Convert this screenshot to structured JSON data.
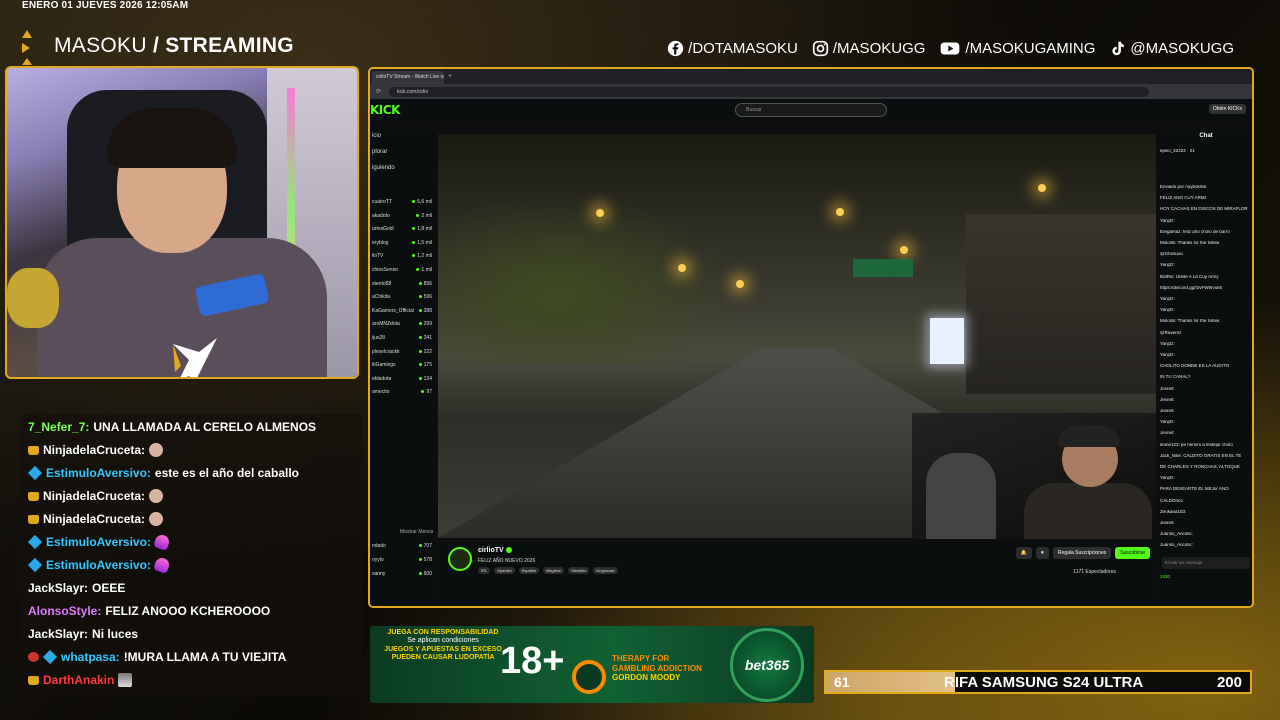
{
  "header": {
    "datetime": "ENERO 01 JUEVES 2026 12:05AM",
    "brand_light": "MASOKU ",
    "brand_bold": "/ STREAMING"
  },
  "socials": [
    {
      "icon": "facebook-icon",
      "label": "/DOTAMASOKU"
    },
    {
      "icon": "instagram-icon",
      "label": "/MASOKUGG"
    },
    {
      "icon": "youtube-icon",
      "label": "/MASOKUGAMING"
    },
    {
      "icon": "tiktok-icon",
      "label": "@MASOKUGG"
    }
  ],
  "overlay_chat": [
    {
      "user": "7_Nefer_7:",
      "color": "#7cff5a",
      "msg": "UNA LLAMADA AL CERELO ALMENOS",
      "badge": "",
      "emote": ""
    },
    {
      "user": "NinjadelaCruceta:",
      "color": "#ffffff",
      "msg": "",
      "badge": "crown",
      "emote": "face"
    },
    {
      "user": "EstimuloAversivo:",
      "color": "#33c7ff",
      "msg": "este es el año del caballo",
      "badge": "cube",
      "emote": ""
    },
    {
      "user": "NinjadelaCruceta:",
      "color": "#ffffff",
      "msg": "",
      "badge": "crown",
      "emote": "face"
    },
    {
      "user": "NinjadelaCruceta:",
      "color": "#ffffff",
      "msg": "",
      "badge": "crown",
      "emote": "face"
    },
    {
      "user": "EstimuloAversivo:",
      "color": "#33c7ff",
      "msg": "",
      "badge": "cube",
      "emote": "flame"
    },
    {
      "user": "EstimuloAversivo:",
      "color": "#33c7ff",
      "msg": "",
      "badge": "cube",
      "emote": "flame"
    },
    {
      "user": "JackSlayr:",
      "color": "#ffffff",
      "msg": "OEEE",
      "badge": "",
      "emote": ""
    },
    {
      "user": "AlonsoStyle:",
      "color": "#e07aff",
      "msg": "FELIZ ANOOO KCHEROOOO",
      "badge": "",
      "emote": ""
    },
    {
      "user": "JackSlayr:",
      "color": "#ffffff",
      "msg": "Ni luces",
      "badge": "",
      "emote": ""
    },
    {
      "user": "whatpasa:",
      "color": "#33c7ff",
      "msg": "!MURA LLAMA A TU VIEJITA",
      "badge": "bugcube",
      "emote": ""
    },
    {
      "user": "DarthAnakin",
      "color": "#ff3b3b",
      "msg": "",
      "badge": "crown",
      "emote": "img"
    }
  ],
  "browser": {
    "tab_title": "cirlioTV Stream - Watch Live on",
    "address": "kick.com/cirlio"
  },
  "kick": {
    "logo": "KICK",
    "search_placeholder": "Buscar",
    "login_label": "Obtén KICKs",
    "nav": [
      "icio",
      "plorar",
      "iguiendo"
    ],
    "channels": [
      {
        "name": "cuatroTT",
        "viewers": "5,6 mil"
      },
      {
        "name": "akadoto",
        "viewers": "2 mil"
      },
      {
        "name": "urinaGold",
        "viewers": "1,8 mil"
      },
      {
        "name": "eryblog",
        "viewers": "1,5 mil"
      },
      {
        "name": "lioTV",
        "viewers": "1,2 mil"
      },
      {
        "name": "chiesSenior",
        "viewers": "1 mil"
      },
      {
        "name": "stento58",
        "viewers": "896"
      },
      {
        "name": "aChikita",
        "viewers": "596"
      },
      {
        "name": "KaGamers_Official",
        "viewers": "388"
      },
      {
        "name": "aroMNZdota",
        "viewers": "299"
      },
      {
        "name": "ijus28",
        "viewers": "241"
      },
      {
        "name": "pleselcrackk",
        "viewers": "222"
      },
      {
        "name": "ltiGamings",
        "viewers": "175"
      },
      {
        "name": "ebladota",
        "viewers": "134"
      },
      {
        "name": "amecito",
        "viewers": "97"
      }
    ],
    "show_less": "Mostrar Menos",
    "recommended": [
      {
        "name": "ndado",
        "viewers": "707"
      },
      {
        "name": "oyylo",
        "viewers": "578"
      },
      {
        "name": "sanny",
        "viewers": "600"
      }
    ],
    "streamer": {
      "name": "cirlioTV",
      "title": "FELIZ AÑO NUEVO 2026",
      "tags": [
        "IRL",
        "Spanish",
        "Español",
        "Mitgleke",
        "Stecktfol",
        "kinghouse"
      ],
      "gift_label": "Regala Suscripciones",
      "subscribe_label": "Suscribirse",
      "viewers": "1171 Espectadores"
    },
    "chat": {
      "title": "Chat",
      "pinned_user": "epsio_22222",
      "pinned_meta": "21",
      "input_placeholder": "Enviar un mensaje",
      "kicks_count": "3430",
      "lines": [
        "Enviado por  nuyboklick",
        "FELIZ AÑO CUY ARMI",
        "HOY CACHAS EN DISCOS DE MIRAFLOR",
        "Yanj3z:",
        "Eregamaz: feliz año cholo de barro",
        "Mololitx: Thanks for the follow",
        "@Ghosuuu",
        "Yanj3z:",
        "BotRix: Unete A La Cuy Army",
        "https://discord.gg/f2vFW9rvuk5",
        "Yanj3z:",
        "Yanj3z:",
        "Mololitx: Thanks for the follow",
        "@Raverez",
        "Yanj3z:",
        "Yanj3z:",
        "CHOLITO DONDE ES LA AUDITO",
        "IN TU CANAL?",
        "Jexnet:",
        "Jexnet:",
        "Jexnet:",
        "Yanj3z:",
        "Jexnet:",
        "leone123: pe hereim a festejar cholo",
        "Jack_Nike: CALDITO GRATIS EN EL TE",
        "DE CHARLES Y RONCHAS, ALTOQUE",
        "Yanj3z:",
        "PARA DESEARTE EL MEJor AÑO",
        "CALDOrico",
        "Zeokana103:",
        "Jexnet:",
        "Juanito_Ancotic:",
        "Juanito_Ancotic:"
      ]
    }
  },
  "ad": {
    "line1": "JUEGA CON RESPONSABILIDAD",
    "line2": "Se aplican condiciones",
    "line3": "JUEGOS Y APUESTAS EN EXCESO",
    "line4": "PUEDEN CAUSAR LUDOPATÍA",
    "age": "18+",
    "therapy1": "THERAPY FOR",
    "therapy2": "GAMBLING ADDICTION",
    "therapy3": "GORDON MOODY",
    "brand": "bet365"
  },
  "raffle": {
    "current": "61",
    "title": "RIFA SAMSUNG S24 ULTRA",
    "goal": "200",
    "progress_fraction": 0.305
  },
  "colors": {
    "accent": "#e2a91c",
    "kick_green": "#53fc18"
  }
}
